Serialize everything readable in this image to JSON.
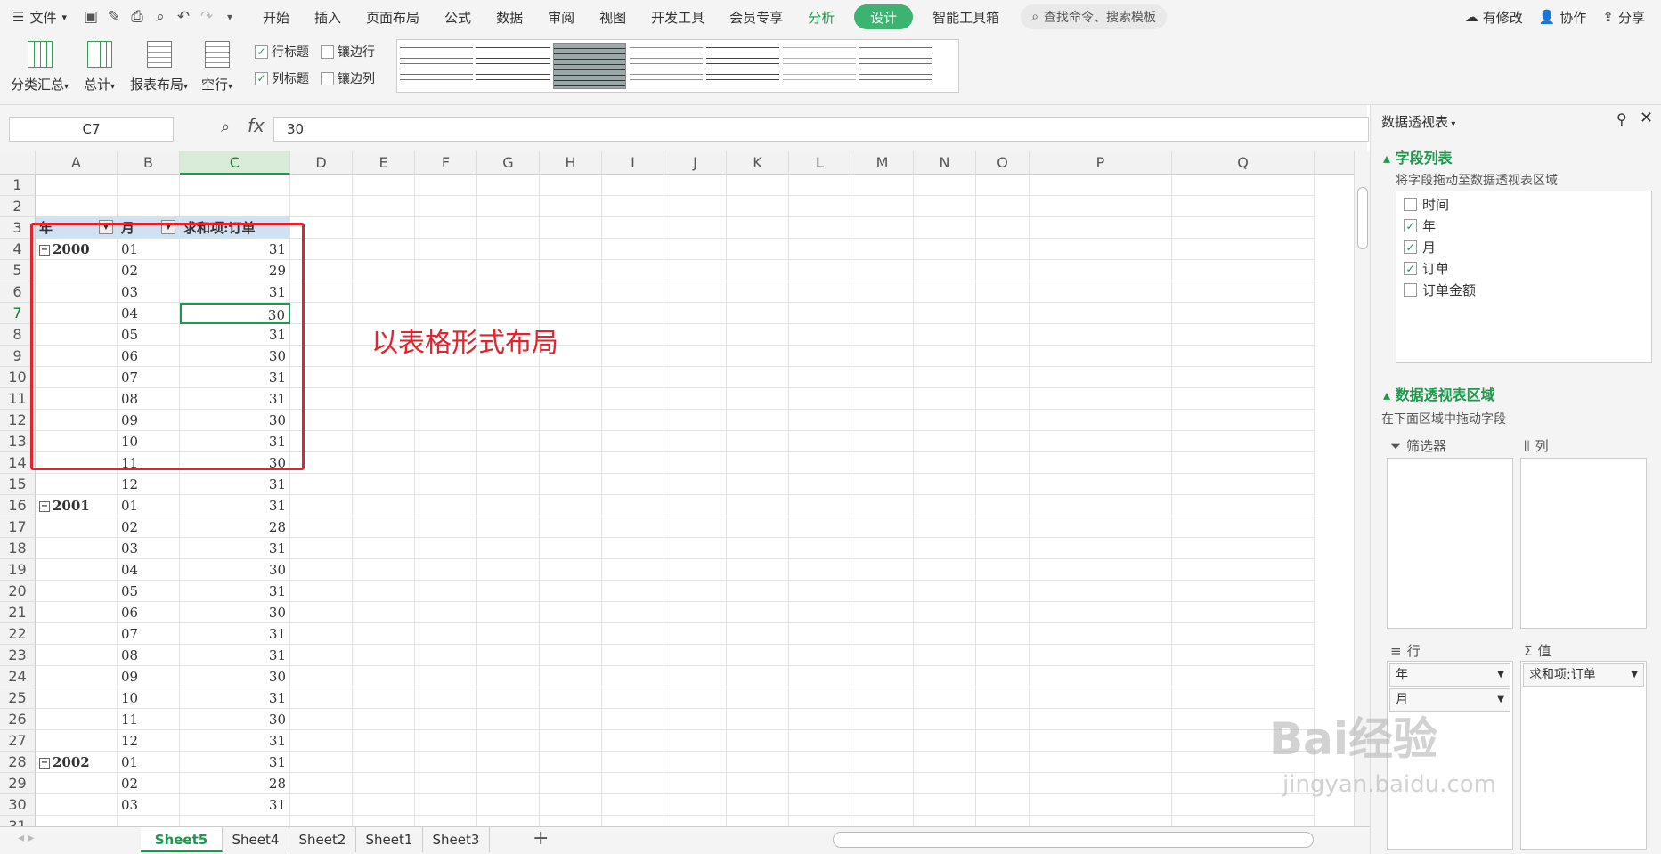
{
  "menubar": {
    "file": "文件",
    "tabs": [
      "开始",
      "插入",
      "页面布局",
      "公式",
      "数据",
      "审阅",
      "视图",
      "开发工具",
      "会员专享"
    ],
    "analyze": "分析",
    "design": "设计",
    "smart_tools": "智能工具箱",
    "search_placeholder": "查找命令、搜索模板",
    "modified": "有修改",
    "collab": "协作",
    "share": "分享"
  },
  "ribbon": {
    "subtotal": "分类汇总",
    "grand_total": "总计",
    "report_layout": "报表布局",
    "blank_rows": "空行",
    "row_headers": "行标题",
    "col_headers": "列标题",
    "banded_rows": "镶边行",
    "banded_cols": "镶边列",
    "row_headers_checked": true,
    "col_headers_checked": true,
    "banded_rows_checked": false,
    "banded_cols_checked": false
  },
  "formula": {
    "name_box": "C7",
    "fx": "fx",
    "value": "30"
  },
  "columns": [
    "A",
    "B",
    "C",
    "D",
    "E",
    "F",
    "G",
    "H",
    "I",
    "J",
    "K",
    "L",
    "M",
    "N",
    "O",
    "P",
    "Q"
  ],
  "selected_column": "C",
  "selected_row": "7",
  "pivot": {
    "header": [
      "年",
      "月",
      "求和项:订单"
    ],
    "rows": [
      {
        "r": "4",
        "year": "2000",
        "month": "01",
        "val": "31"
      },
      {
        "r": "5",
        "year": "",
        "month": "02",
        "val": "29"
      },
      {
        "r": "6",
        "year": "",
        "month": "03",
        "val": "31"
      },
      {
        "r": "7",
        "year": "",
        "month": "04",
        "val": "30"
      },
      {
        "r": "8",
        "year": "",
        "month": "05",
        "val": "31"
      },
      {
        "r": "9",
        "year": "",
        "month": "06",
        "val": "30"
      },
      {
        "r": "10",
        "year": "",
        "month": "07",
        "val": "31"
      },
      {
        "r": "11",
        "year": "",
        "month": "08",
        "val": "31"
      },
      {
        "r": "12",
        "year": "",
        "month": "09",
        "val": "30"
      },
      {
        "r": "13",
        "year": "",
        "month": "10",
        "val": "31"
      },
      {
        "r": "14",
        "year": "",
        "month": "11",
        "val": "30"
      },
      {
        "r": "15",
        "year": "",
        "month": "12",
        "val": "31"
      },
      {
        "r": "16",
        "year": "2001",
        "month": "01",
        "val": "31"
      },
      {
        "r": "17",
        "year": "",
        "month": "02",
        "val": "28"
      },
      {
        "r": "18",
        "year": "",
        "month": "03",
        "val": "31"
      },
      {
        "r": "19",
        "year": "",
        "month": "04",
        "val": "30"
      },
      {
        "r": "20",
        "year": "",
        "month": "05",
        "val": "31"
      },
      {
        "r": "21",
        "year": "",
        "month": "06",
        "val": "30"
      },
      {
        "r": "22",
        "year": "",
        "month": "07",
        "val": "31"
      },
      {
        "r": "23",
        "year": "",
        "month": "08",
        "val": "31"
      },
      {
        "r": "24",
        "year": "",
        "month": "09",
        "val": "30"
      },
      {
        "r": "25",
        "year": "",
        "month": "10",
        "val": "31"
      },
      {
        "r": "26",
        "year": "",
        "month": "11",
        "val": "30"
      },
      {
        "r": "27",
        "year": "",
        "month": "12",
        "val": "31"
      },
      {
        "r": "28",
        "year": "2002",
        "month": "01",
        "val": "31"
      },
      {
        "r": "29",
        "year": "",
        "month": "02",
        "val": "28"
      },
      {
        "r": "30",
        "year": "",
        "month": "03",
        "val": "31"
      }
    ]
  },
  "annotation": "以表格形式布局",
  "sheet_tabs": [
    "Sheet5",
    "Sheet4",
    "Sheet2",
    "Sheet1",
    "Sheet3"
  ],
  "active_sheet": "Sheet5",
  "panel": {
    "title": "数据透视表",
    "field_list_title": "字段列表",
    "field_list_hint": "将字段拖动至数据透视表区域",
    "fields": [
      {
        "name": "时间",
        "checked": false
      },
      {
        "name": "年",
        "checked": true
      },
      {
        "name": "月",
        "checked": true
      },
      {
        "name": "订单",
        "checked": true
      },
      {
        "name": "订单金额",
        "checked": false
      }
    ],
    "areas_title": "数据透视表区域",
    "areas_hint": "在下面区域中拖动字段",
    "filter_label": "筛选器",
    "column_label": "列",
    "row_label": "行",
    "value_label": "值",
    "row_items": [
      "年",
      "月"
    ],
    "value_items": [
      "求和项:订单"
    ]
  },
  "watermark": {
    "main": "Bai经验",
    "sub": "jingyan.baidu.com"
  },
  "colors": {
    "accent": "#1a9a4a",
    "annotation": "#e6232b"
  }
}
